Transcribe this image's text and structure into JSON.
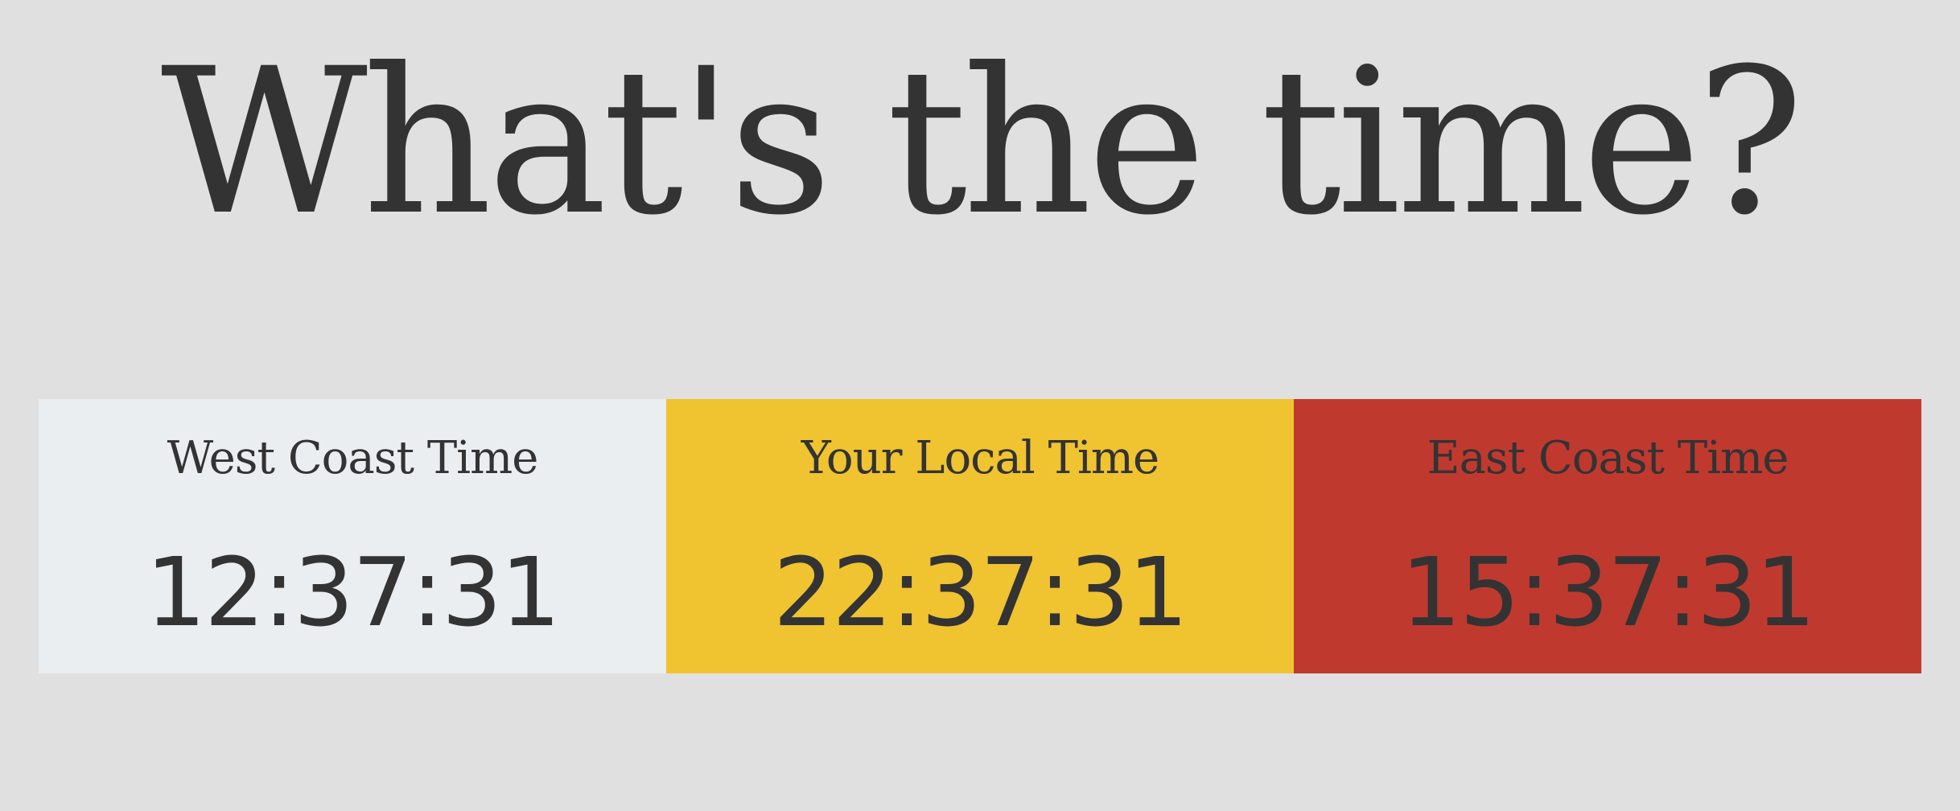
{
  "header": {
    "title": "What's the time?"
  },
  "colors": {
    "background": "#e0e0e0",
    "text": "#333333"
  },
  "clocks": [
    {
      "label": "West Coast Time",
      "time": "12:37:31",
      "color": "#ebeef0"
    },
    {
      "label": "Your Local Time",
      "time": "22:37:31",
      "color": "#f0c330"
    },
    {
      "label": "East Coast Time",
      "time": "15:37:31",
      "color": "#c0392f"
    }
  ]
}
